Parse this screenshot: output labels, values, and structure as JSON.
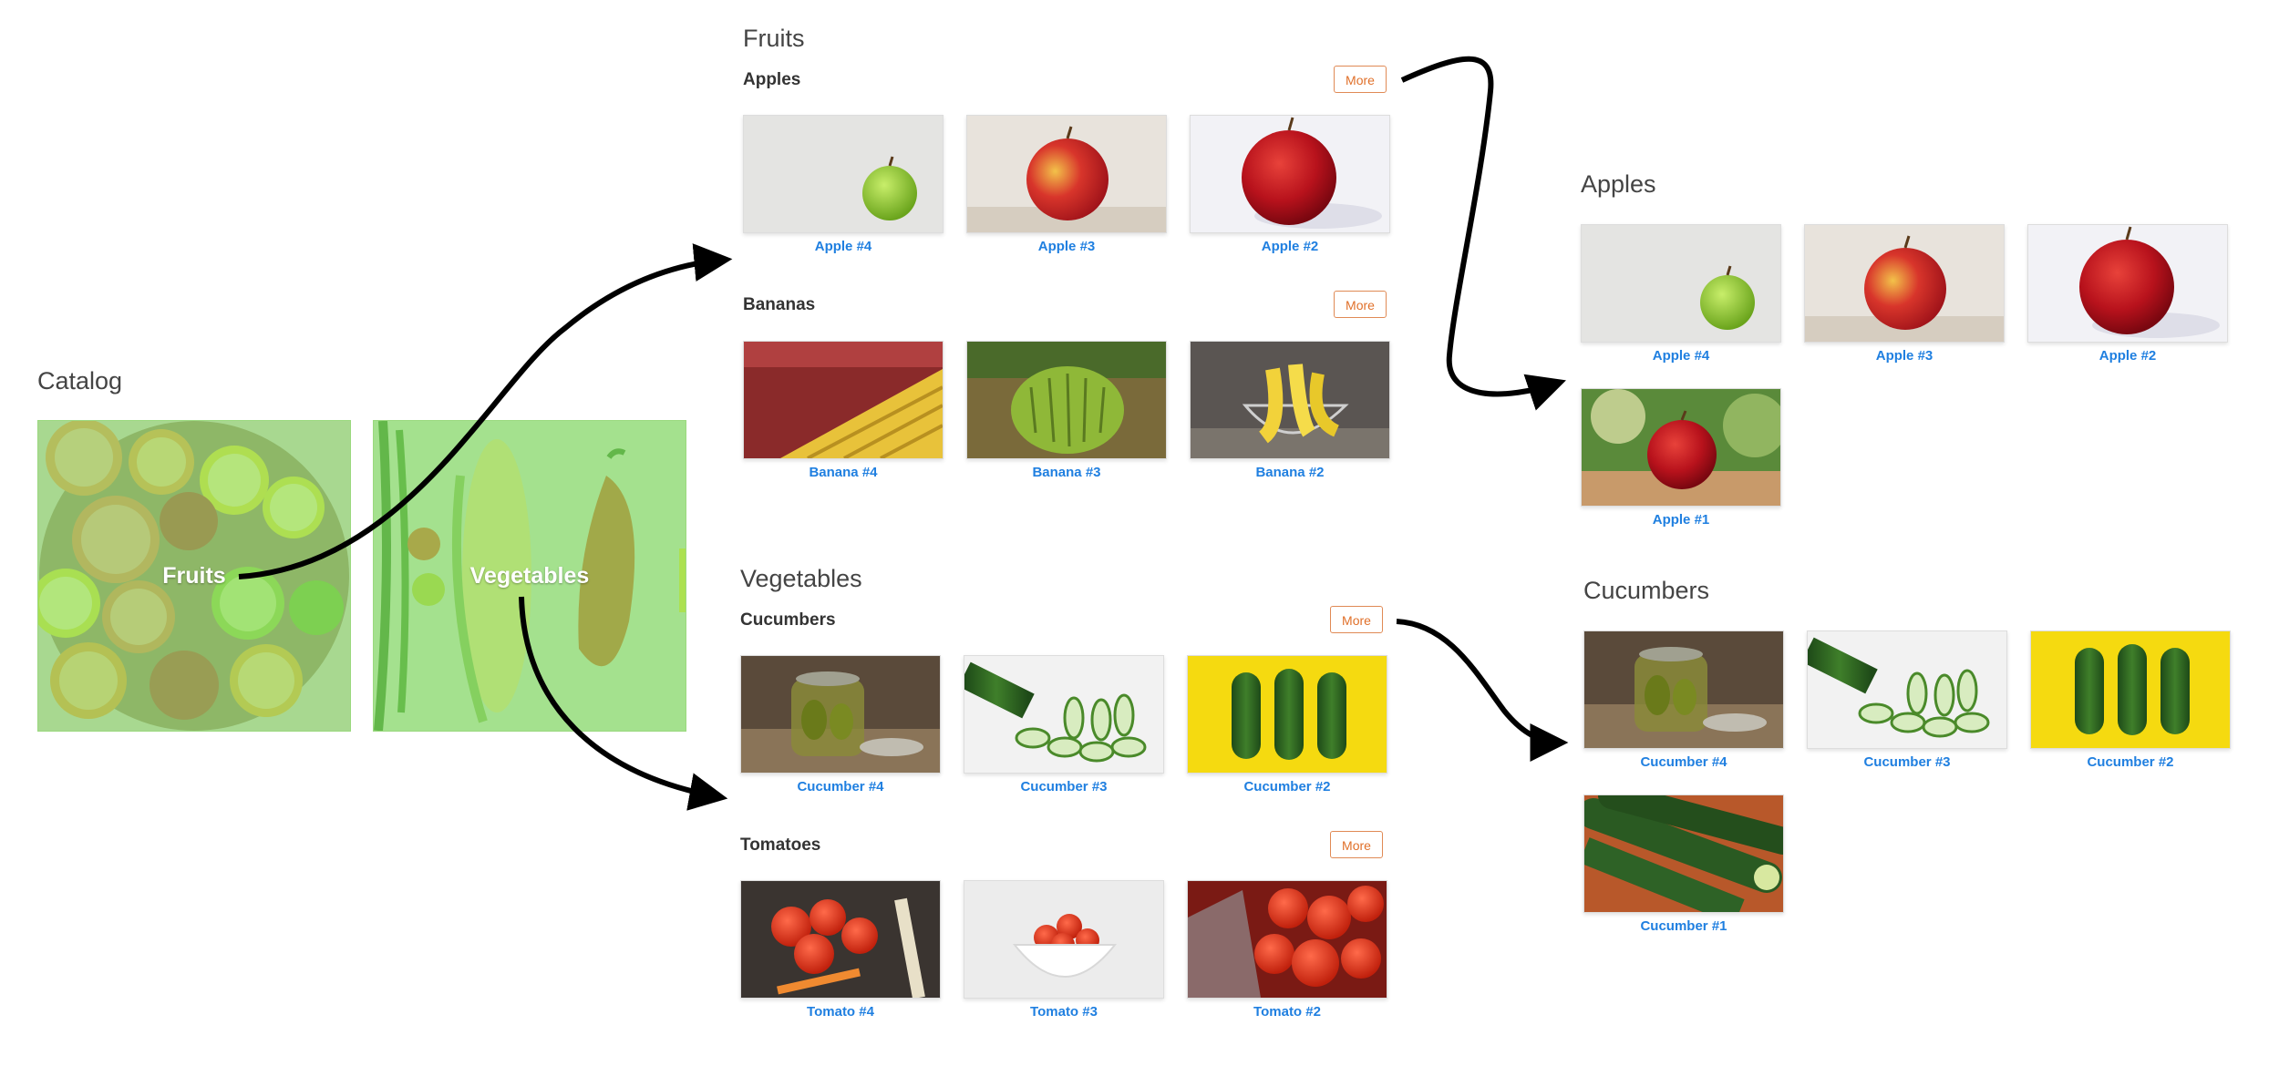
{
  "catalog": {
    "title": "Catalog",
    "fruits_label": "Fruits",
    "vegetables_label": "Vegetables"
  },
  "fruits": {
    "title": "Fruits",
    "apples": {
      "title": "Apples",
      "more": "More",
      "items": [
        "Apple #4",
        "Apple #3",
        "Apple #2"
      ]
    },
    "bananas": {
      "title": "Bananas",
      "more": "More",
      "items": [
        "Banana #4",
        "Banana #3",
        "Banana #2"
      ]
    }
  },
  "vegetables": {
    "title": "Vegetables",
    "cucumbers": {
      "title": "Cucumbers",
      "more": "More",
      "items": [
        "Cucumber #4",
        "Cucumber #3",
        "Cucumber #2"
      ]
    },
    "tomatoes": {
      "title": "Tomatoes",
      "more": "More",
      "items": [
        "Tomato #4",
        "Tomato #3",
        "Tomato #2"
      ]
    }
  },
  "apples_page": {
    "title": "Apples",
    "items": [
      "Apple #4",
      "Apple #3",
      "Apple #2",
      "Apple #1"
    ]
  },
  "cucumbers_page": {
    "title": "Cucumbers",
    "items": [
      "Cucumber #4",
      "Cucumber #3",
      "Cucumber #2",
      "Cucumber #1"
    ]
  },
  "colors": {
    "link": "#1f7fe0",
    "more_button": "#e0702a",
    "catalog_overlay": "#82dc64"
  }
}
